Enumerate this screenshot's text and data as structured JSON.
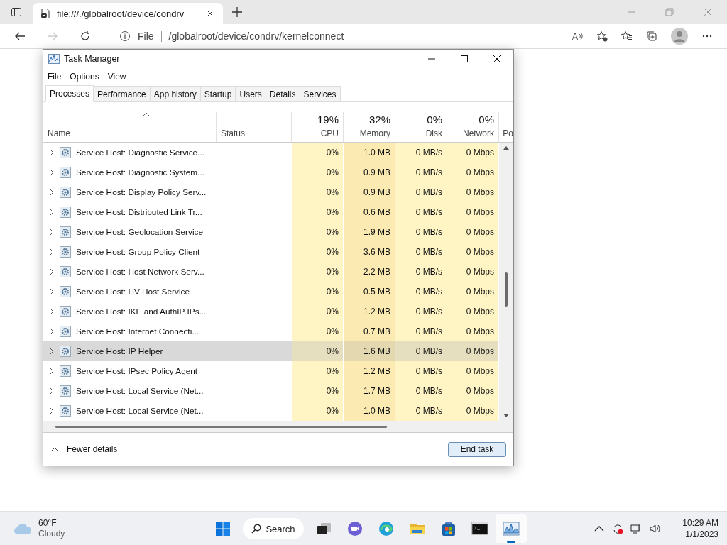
{
  "browser": {
    "tab_title": "file:///./globalroot/device/condrv",
    "address_scheme": "File",
    "address": "/globalroot/device/condrv/kernelconnect"
  },
  "task_manager": {
    "title": "Task Manager",
    "menu": [
      "File",
      "Options",
      "View"
    ],
    "tabs": [
      {
        "label": "Processes",
        "selected": true
      },
      {
        "label": "Performance",
        "selected": false
      },
      {
        "label": "App history",
        "selected": false
      },
      {
        "label": "Startup",
        "selected": false
      },
      {
        "label": "Users",
        "selected": false
      },
      {
        "label": "Details",
        "selected": false
      },
      {
        "label": "Services",
        "selected": false
      }
    ],
    "columns": [
      {
        "label": "Name"
      },
      {
        "label": "Status"
      },
      {
        "usage": "19%",
        "label": "CPU"
      },
      {
        "usage": "32%",
        "label": "Memory"
      },
      {
        "usage": "0%",
        "label": "Disk"
      },
      {
        "usage": "0%",
        "label": "Network"
      },
      {
        "label": "Po"
      }
    ],
    "rows": [
      {
        "name": "Service Host: Diagnostic Service...",
        "cpu": "0%",
        "memory": "1.0 MB",
        "disk": "0 MB/s",
        "network": "0 Mbps",
        "selected": false
      },
      {
        "name": "Service Host: Diagnostic System...",
        "cpu": "0%",
        "memory": "0.9 MB",
        "disk": "0 MB/s",
        "network": "0 Mbps",
        "selected": false
      },
      {
        "name": "Service Host: Display Policy Serv...",
        "cpu": "0%",
        "memory": "0.9 MB",
        "disk": "0 MB/s",
        "network": "0 Mbps",
        "selected": false
      },
      {
        "name": "Service Host: Distributed Link Tr...",
        "cpu": "0%",
        "memory": "0.6 MB",
        "disk": "0 MB/s",
        "network": "0 Mbps",
        "selected": false
      },
      {
        "name": "Service Host: Geolocation Service",
        "cpu": "0%",
        "memory": "1.9 MB",
        "disk": "0 MB/s",
        "network": "0 Mbps",
        "selected": false
      },
      {
        "name": "Service Host: Group Policy Client",
        "cpu": "0%",
        "memory": "3.6 MB",
        "disk": "0 MB/s",
        "network": "0 Mbps",
        "selected": false
      },
      {
        "name": "Service Host: Host Network Serv...",
        "cpu": "0%",
        "memory": "2.2 MB",
        "disk": "0 MB/s",
        "network": "0 Mbps",
        "selected": false
      },
      {
        "name": "Service Host: HV Host Service",
        "cpu": "0%",
        "memory": "0.5 MB",
        "disk": "0 MB/s",
        "network": "0 Mbps",
        "selected": false
      },
      {
        "name": "Service Host: IKE and AuthIP IPs...",
        "cpu": "0%",
        "memory": "1.2 MB",
        "disk": "0 MB/s",
        "network": "0 Mbps",
        "selected": false
      },
      {
        "name": "Service Host: Internet Connecti...",
        "cpu": "0%",
        "memory": "0.7 MB",
        "disk": "0 MB/s",
        "network": "0 Mbps",
        "selected": false
      },
      {
        "name": "Service Host: IP Helper",
        "cpu": "0%",
        "memory": "1.6 MB",
        "disk": "0 MB/s",
        "network": "0 Mbps",
        "selected": true
      },
      {
        "name": "Service Host: IPsec Policy Agent",
        "cpu": "0%",
        "memory": "1.2 MB",
        "disk": "0 MB/s",
        "network": "0 Mbps",
        "selected": false
      },
      {
        "name": "Service Host: Local Service (Net...",
        "cpu": "0%",
        "memory": "1.7 MB",
        "disk": "0 MB/s",
        "network": "0 Mbps",
        "selected": false
      },
      {
        "name": "Service Host: Local Service (Net...",
        "cpu": "0%",
        "memory": "1.0 MB",
        "disk": "0 MB/s",
        "network": "0 Mbps",
        "selected": false
      }
    ],
    "footer": {
      "toggle": "Fewer details",
      "button": "End task"
    }
  },
  "taskbar": {
    "temperature": "60°F",
    "condition": "Cloudy",
    "search": "Search",
    "time": "10:29 AM",
    "date": "1/1/2023"
  }
}
